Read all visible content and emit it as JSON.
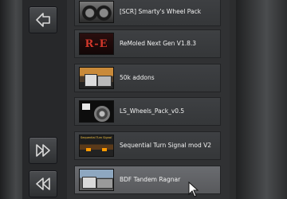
{
  "mod_list": {
    "items": [
      {
        "label": "[SCR] Smarty's Wheel Pack",
        "thumb_icon": "wheel-pack-thumbnail"
      },
      {
        "label": "ReMoled Next Gen V1.8.3",
        "thumb_icon": "remoled-logo-thumbnail"
      },
      {
        "label": "50k addons",
        "thumb_icon": "truck-addons-thumbnail"
      },
      {
        "label": "LS_Wheels_Pack_v0.5",
        "thumb_icon": "wheels-pack-thumbnail"
      },
      {
        "label": "Sequential Turn Signal mod V2",
        "thumb_icon": "turn-signal-thumbnail"
      },
      {
        "label": "BDF Tandem Ragnar",
        "thumb_icon": "tandem-truck-thumbnail"
      }
    ],
    "selected_index": 5
  },
  "thumb_texts": {
    "remoled": "R-E",
    "turn_signal": "Sequential Turn Signal"
  },
  "nav": {
    "back_icon": "back-arrow-icon",
    "forward_icon": "fast-forward-icon",
    "rewind_icon": "rewind-icon"
  },
  "colors": {
    "row_bg": "#3a3c3f",
    "row_selected_bg": "#606265",
    "text": "#f2f2f2",
    "accent_red": "#c0392b"
  }
}
